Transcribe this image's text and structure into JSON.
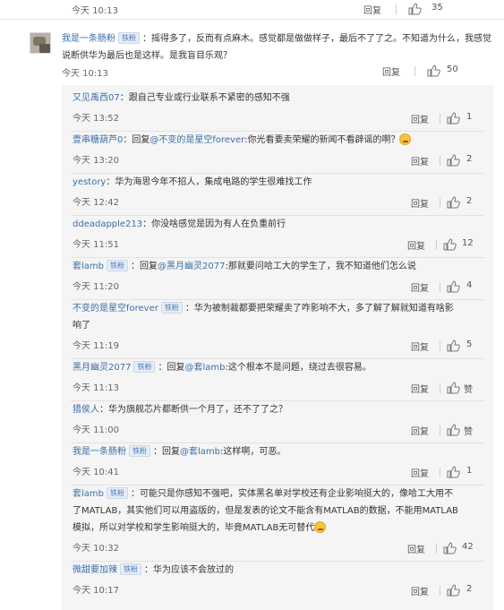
{
  "top": {
    "time": "今天 10:13",
    "reply": "回复",
    "likes": "35"
  },
  "main": {
    "user": "我是一条肠粉",
    "badge": "铁粉",
    "text": "：摇得多了，反而有点麻木。感觉都是做做样子，最后不了了之。不知道为什么，我感觉说断供华为最后也是这样。是我盲目乐观？",
    "time": "今天 10:13",
    "reply": "回复",
    "likes": "50"
  },
  "replies": [
    {
      "user": "又见禹西07",
      "badge": "",
      "pre": "",
      "mention": "",
      "text": "：跟自己专业或行业联系不紧密的感知不强",
      "emoji": false,
      "time": "今天 13:52",
      "reply": "回复",
      "likes": "1"
    },
    {
      "user": "壹串糖葫芦0",
      "badge": "",
      "pre": "：回复",
      "mention": "@不变的是星空forever",
      "text": ":你光看要卖荣耀的新闻不看辟谣的啊？",
      "emoji": true,
      "time": "今天 13:20",
      "reply": "回复",
      "likes": "2"
    },
    {
      "user": "yestory",
      "badge": "",
      "pre": "",
      "mention": "",
      "text": "：华为海思今年不招人，集成电路的学生很难找工作",
      "emoji": false,
      "time": "今天 12:42",
      "reply": "回复",
      "likes": "2"
    },
    {
      "user": "ddeadapple213",
      "badge": "",
      "pre": "",
      "mention": "",
      "text": "：你没啥感觉是因为有人在负重前行",
      "emoji": false,
      "time": "今天 11:51",
      "reply": "回复",
      "likes": "12"
    },
    {
      "user": "套lamb",
      "badge": "铁粉",
      "pre": "：回复",
      "mention": "@黑月幽灵2077",
      "text": ":那就要问哈工大的学生了，我不知道他们怎么说",
      "emoji": false,
      "time": "今天 11:20",
      "reply": "回复",
      "likes": "4"
    },
    {
      "user": "不变的是星空forever",
      "badge": "铁粉",
      "pre": "",
      "mention": "",
      "text": "：华为被制裁都要把荣耀卖了咋影响不大，多了解了解就知道有啥影响了",
      "emoji": false,
      "time": "今天 11:19",
      "reply": "回复",
      "likes": "5"
    },
    {
      "user": "黑月幽灵2077",
      "badge": "铁粉",
      "pre": "：回复",
      "mention": "@套lamb",
      "text": ":这个根本不是问题，绕过去很容易。",
      "emoji": false,
      "time": "今天 11:13",
      "reply": "回复",
      "likes": "赞"
    },
    {
      "user": "猎侯人",
      "badge": "",
      "pre": "",
      "mention": "",
      "text": "：华为旗舰芯片都断供一个月了，还不了了之？",
      "emoji": false,
      "time": "今天 11:00",
      "reply": "回复",
      "likes": "赞"
    },
    {
      "user": "我是一条肠粉",
      "badge": "铁粉",
      "pre": "：回复",
      "mention": "@套lamb",
      "text": ":这样啊，可恶。",
      "emoji": false,
      "time": "今天 10:41",
      "reply": "回复",
      "likes": "1"
    },
    {
      "user": "套lamb",
      "badge": "铁粉",
      "pre": "",
      "mention": "",
      "text": "：可能只是你感知不强吧，实体黑名单对学校还有企业影响挺大的，像哈工大用不了MATLAB，其实他们可以用盗版的，但是发表的论文不能含有MATLAB的数据，不能用MATLAB模拟，所以对学校和学生影响挺大的，毕竟MATLAB无可替代",
      "emoji": true,
      "time": "今天 10:32",
      "reply": "回复",
      "likes": "42"
    },
    {
      "user": "微甜要加辣",
      "badge": "铁粉",
      "pre": "",
      "mention": "",
      "text": "：华为应该不会放过的",
      "emoji": false,
      "time": "今天 10:17",
      "reply": "回复",
      "likes": "2"
    }
  ],
  "colors": {
    "link": "#3b6fa6",
    "text": "#333333",
    "muted": "#666666",
    "reply_bg": "#f5f5f5"
  },
  "icons": {
    "like": "thumbs-up-icon"
  }
}
